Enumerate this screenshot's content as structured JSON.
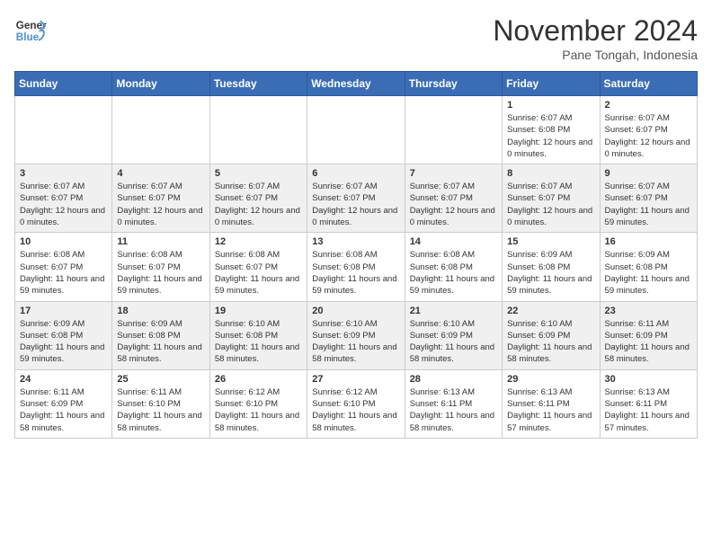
{
  "header": {
    "logo_line1": "General",
    "logo_line2": "Blue",
    "month": "November 2024",
    "location": "Pane Tongah, Indonesia"
  },
  "weekdays": [
    "Sunday",
    "Monday",
    "Tuesday",
    "Wednesday",
    "Thursday",
    "Friday",
    "Saturday"
  ],
  "weeks": [
    [
      {
        "day": "",
        "info": ""
      },
      {
        "day": "",
        "info": ""
      },
      {
        "day": "",
        "info": ""
      },
      {
        "day": "",
        "info": ""
      },
      {
        "day": "",
        "info": ""
      },
      {
        "day": "1",
        "info": "Sunrise: 6:07 AM\nSunset: 6:08 PM\nDaylight: 12 hours and 0 minutes."
      },
      {
        "day": "2",
        "info": "Sunrise: 6:07 AM\nSunset: 6:07 PM\nDaylight: 12 hours and 0 minutes."
      }
    ],
    [
      {
        "day": "3",
        "info": "Sunrise: 6:07 AM\nSunset: 6:07 PM\nDaylight: 12 hours and 0 minutes."
      },
      {
        "day": "4",
        "info": "Sunrise: 6:07 AM\nSunset: 6:07 PM\nDaylight: 12 hours and 0 minutes."
      },
      {
        "day": "5",
        "info": "Sunrise: 6:07 AM\nSunset: 6:07 PM\nDaylight: 12 hours and 0 minutes."
      },
      {
        "day": "6",
        "info": "Sunrise: 6:07 AM\nSunset: 6:07 PM\nDaylight: 12 hours and 0 minutes."
      },
      {
        "day": "7",
        "info": "Sunrise: 6:07 AM\nSunset: 6:07 PM\nDaylight: 12 hours and 0 minutes."
      },
      {
        "day": "8",
        "info": "Sunrise: 6:07 AM\nSunset: 6:07 PM\nDaylight: 12 hours and 0 minutes."
      },
      {
        "day": "9",
        "info": "Sunrise: 6:07 AM\nSunset: 6:07 PM\nDaylight: 11 hours and 59 minutes."
      }
    ],
    [
      {
        "day": "10",
        "info": "Sunrise: 6:08 AM\nSunset: 6:07 PM\nDaylight: 11 hours and 59 minutes."
      },
      {
        "day": "11",
        "info": "Sunrise: 6:08 AM\nSunset: 6:07 PM\nDaylight: 11 hours and 59 minutes."
      },
      {
        "day": "12",
        "info": "Sunrise: 6:08 AM\nSunset: 6:07 PM\nDaylight: 11 hours and 59 minutes."
      },
      {
        "day": "13",
        "info": "Sunrise: 6:08 AM\nSunset: 6:08 PM\nDaylight: 11 hours and 59 minutes."
      },
      {
        "day": "14",
        "info": "Sunrise: 6:08 AM\nSunset: 6:08 PM\nDaylight: 11 hours and 59 minutes."
      },
      {
        "day": "15",
        "info": "Sunrise: 6:09 AM\nSunset: 6:08 PM\nDaylight: 11 hours and 59 minutes."
      },
      {
        "day": "16",
        "info": "Sunrise: 6:09 AM\nSunset: 6:08 PM\nDaylight: 11 hours and 59 minutes."
      }
    ],
    [
      {
        "day": "17",
        "info": "Sunrise: 6:09 AM\nSunset: 6:08 PM\nDaylight: 11 hours and 59 minutes."
      },
      {
        "day": "18",
        "info": "Sunrise: 6:09 AM\nSunset: 6:08 PM\nDaylight: 11 hours and 58 minutes."
      },
      {
        "day": "19",
        "info": "Sunrise: 6:10 AM\nSunset: 6:08 PM\nDaylight: 11 hours and 58 minutes."
      },
      {
        "day": "20",
        "info": "Sunrise: 6:10 AM\nSunset: 6:09 PM\nDaylight: 11 hours and 58 minutes."
      },
      {
        "day": "21",
        "info": "Sunrise: 6:10 AM\nSunset: 6:09 PM\nDaylight: 11 hours and 58 minutes."
      },
      {
        "day": "22",
        "info": "Sunrise: 6:10 AM\nSunset: 6:09 PM\nDaylight: 11 hours and 58 minutes."
      },
      {
        "day": "23",
        "info": "Sunrise: 6:11 AM\nSunset: 6:09 PM\nDaylight: 11 hours and 58 minutes."
      }
    ],
    [
      {
        "day": "24",
        "info": "Sunrise: 6:11 AM\nSunset: 6:09 PM\nDaylight: 11 hours and 58 minutes."
      },
      {
        "day": "25",
        "info": "Sunrise: 6:11 AM\nSunset: 6:10 PM\nDaylight: 11 hours and 58 minutes."
      },
      {
        "day": "26",
        "info": "Sunrise: 6:12 AM\nSunset: 6:10 PM\nDaylight: 11 hours and 58 minutes."
      },
      {
        "day": "27",
        "info": "Sunrise: 6:12 AM\nSunset: 6:10 PM\nDaylight: 11 hours and 58 minutes."
      },
      {
        "day": "28",
        "info": "Sunrise: 6:13 AM\nSunset: 6:11 PM\nDaylight: 11 hours and 58 minutes."
      },
      {
        "day": "29",
        "info": "Sunrise: 6:13 AM\nSunset: 6:11 PM\nDaylight: 11 hours and 57 minutes."
      },
      {
        "day": "30",
        "info": "Sunrise: 6:13 AM\nSunset: 6:11 PM\nDaylight: 11 hours and 57 minutes."
      }
    ]
  ]
}
